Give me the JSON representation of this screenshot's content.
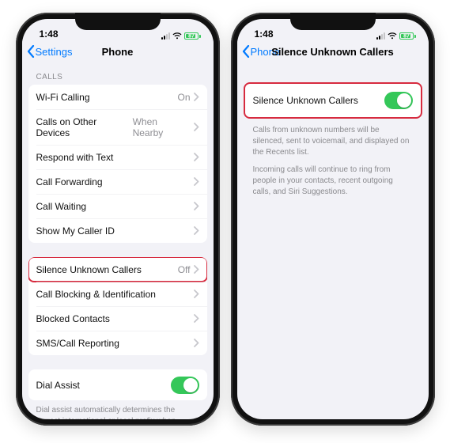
{
  "colors": {
    "accent_blue": "#007aff",
    "toggle_green": "#34c759",
    "highlight_red": "#d72b3f",
    "separator": "#e5e5ea",
    "bg_grouped": "#f2f2f7",
    "secondary_text": "#8e8e93"
  },
  "status": {
    "time": "1:48",
    "battery_text": "87"
  },
  "phone1": {
    "back_label": "Settings",
    "title": "Phone",
    "section_calls_header": "CALLS",
    "rows_calls": [
      {
        "label": "Wi-Fi Calling",
        "detail": "On",
        "chevron": true
      },
      {
        "label": "Calls on Other Devices",
        "detail": "When Nearby",
        "chevron": true
      },
      {
        "label": "Respond with Text",
        "detail": "",
        "chevron": true
      },
      {
        "label": "Call Forwarding",
        "detail": "",
        "chevron": true
      },
      {
        "label": "Call Waiting",
        "detail": "",
        "chevron": true
      },
      {
        "label": "Show My Caller ID",
        "detail": "",
        "chevron": true
      }
    ],
    "rows_silence": [
      {
        "label": "Silence Unknown Callers",
        "detail": "Off",
        "chevron": true,
        "highlight": true
      },
      {
        "label": "Call Blocking & Identification",
        "detail": "",
        "chevron": true
      },
      {
        "label": "Blocked Contacts",
        "detail": "",
        "chevron": true
      },
      {
        "label": "SMS/Call Reporting",
        "detail": "",
        "chevron": true
      }
    ],
    "dial_assist": {
      "label": "Dial Assist",
      "on": true
    },
    "dial_assist_note": "Dial assist automatically determines the correct international or local prefix when dialing."
  },
  "phone2": {
    "back_label": "Phone",
    "title": "Silence Unknown Callers",
    "row": {
      "label": "Silence Unknown Callers",
      "on": true
    },
    "note1": "Calls from unknown numbers will be silenced, sent to voicemail, and displayed on the Recents list.",
    "note2": "Incoming calls will continue to ring from people in your contacts, recent outgoing calls, and Siri Suggestions."
  }
}
